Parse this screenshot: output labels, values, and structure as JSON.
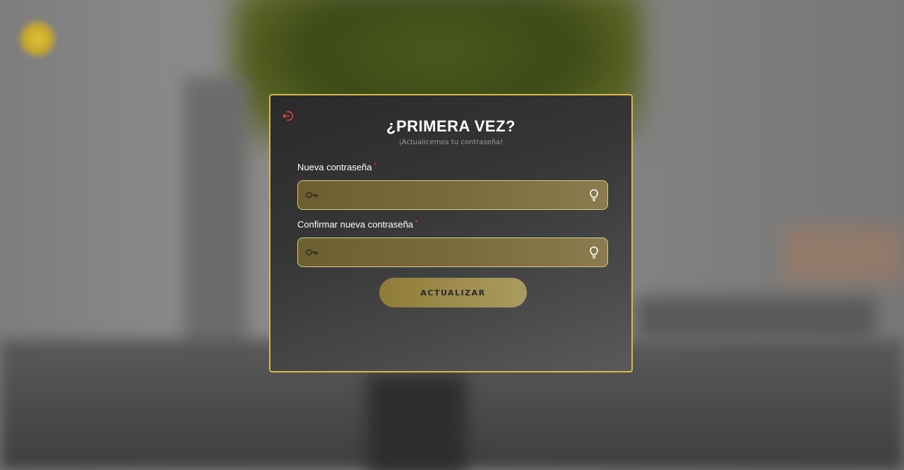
{
  "modal": {
    "title": "¿PRIMERA VEZ?",
    "subtitle": "¡Actualicemos tu contraseña!",
    "exit_icon": "logout-icon"
  },
  "fields": [
    {
      "label": "Nueva contraseña",
      "required_mark": "*",
      "value": "",
      "placeholder": "",
      "left_icon": "key-icon",
      "right_icon": "lightbulb-icon"
    },
    {
      "label": "Confirmar nueva contraseña",
      "required_mark": "*",
      "value": "",
      "placeholder": "",
      "left_icon": "key-icon",
      "right_icon": "lightbulb-icon"
    }
  ],
  "submit_label": "ACTUALIZAR",
  "colors": {
    "accent_gold": "#d6b94a",
    "required_red": "#d9443a",
    "exit_icon_red": "#e04646"
  }
}
